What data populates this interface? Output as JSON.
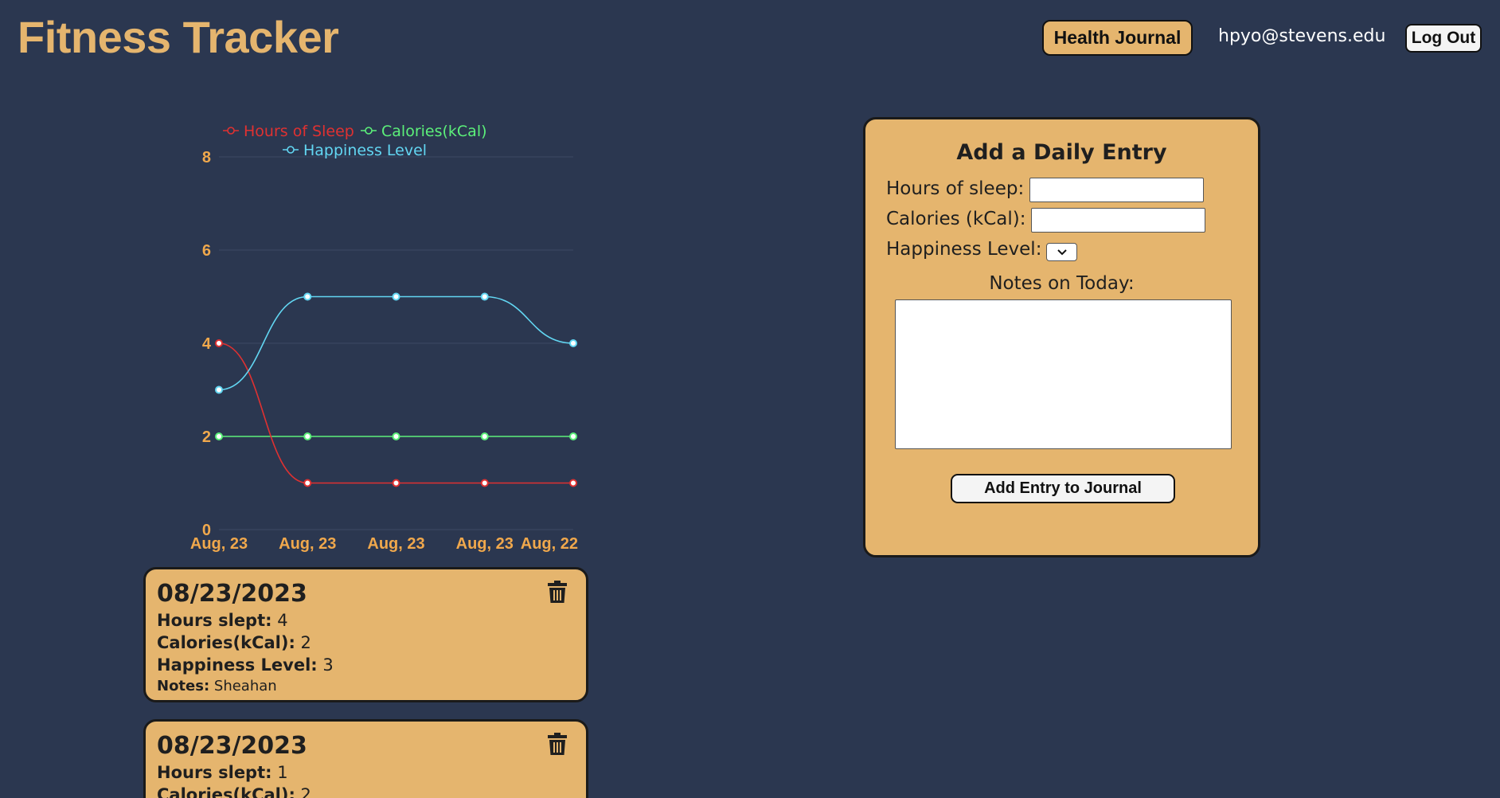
{
  "header": {
    "title": "Fitness Tracker",
    "journal_label": "Health Journal",
    "user_email": "hpyo@stevens.edu",
    "logout_label": "Log Out"
  },
  "chart_data": {
    "type": "line",
    "categories": [
      "Aug, 23",
      "Aug, 23",
      "Aug, 23",
      "Aug, 23",
      "Aug, 22"
    ],
    "series": [
      {
        "name": "Hours of Sleep",
        "values": [
          4,
          1,
          1,
          1,
          1
        ],
        "color": "#e03131"
      },
      {
        "name": "Calories(kCal)",
        "values": [
          2,
          2,
          2,
          2,
          2
        ],
        "color": "#5cf07a"
      },
      {
        "name": "Happiness Level",
        "values": [
          3,
          5,
          5,
          5,
          4
        ],
        "color": "#62d6f2"
      }
    ],
    "yticks": [
      0,
      2,
      4,
      6,
      8
    ],
    "ylim": [
      0,
      8
    ],
    "grid": true,
    "legend_position": "top",
    "tick_color": "#f0a84c"
  },
  "entries": [
    {
      "date": "08/23/2023",
      "hours_label": "Hours slept:",
      "hours": "4",
      "calories_label": "Calories(kCal):",
      "calories": "2",
      "happiness_label": "Happiness Level:",
      "happiness": "3",
      "notes_label": "Notes:",
      "notes": "Sheahan"
    },
    {
      "date": "08/23/2023",
      "hours_label": "Hours slept:",
      "hours": "1",
      "calories_label": "Calories(kCal):",
      "calories": "2"
    }
  ],
  "form": {
    "title": "Add a Daily Entry",
    "sleep_label": "Hours of sleep:",
    "calories_label": "Calories (kCal):",
    "happiness_label": "Happiness Level:",
    "notes_label": "Notes on Today:",
    "submit_label": "Add Entry to Journal"
  },
  "colors": {
    "background": "#2b3750",
    "accent": "#e5b56e",
    "tick": "#f0a84c"
  }
}
